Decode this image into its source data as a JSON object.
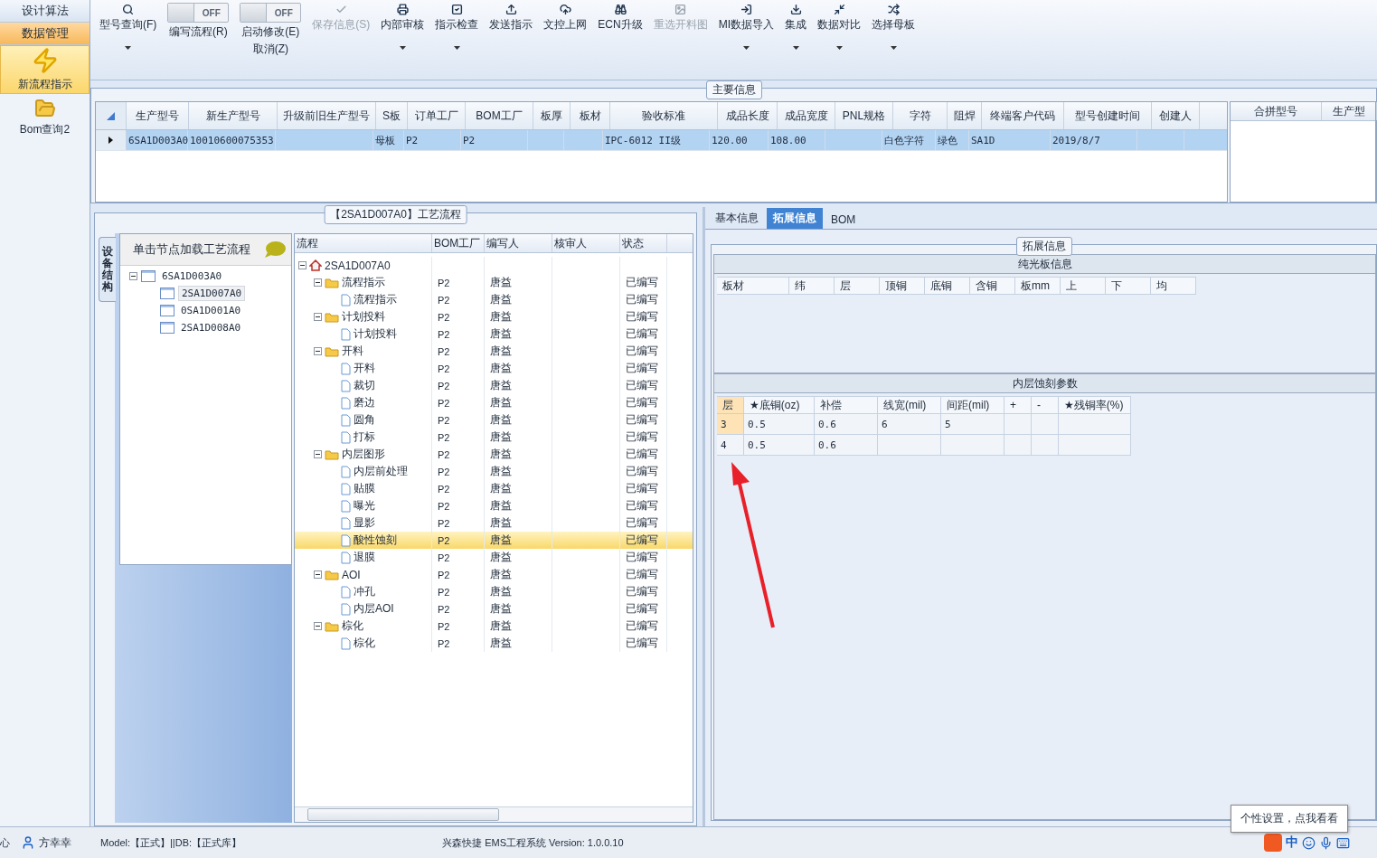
{
  "sidebar": {
    "tabs": [
      {
        "label": "设计算法",
        "selected": false
      },
      {
        "label": "数据管理",
        "selected": true
      }
    ],
    "buttons": [
      {
        "label": "新流程指示",
        "selected": true
      },
      {
        "label": "Bom查询2",
        "selected": false
      }
    ]
  },
  "toolbar": [
    {
      "kind": "button",
      "label": "型号查询(F)",
      "disabled": false,
      "dropdown": true
    },
    {
      "kind": "toggle",
      "label": "编写流程(R)",
      "switch": "OFF",
      "on": false
    },
    {
      "kind": "toggle",
      "label": "启动修改(E)",
      "label_2": "取消(Z)",
      "switch": "OFF",
      "on": false
    },
    {
      "kind": "button",
      "label": "保存信息(S)",
      "disabled": true,
      "dropdown": false
    },
    {
      "kind": "button",
      "label": "内部审核",
      "disabled": false,
      "dropdown": true
    },
    {
      "kind": "button",
      "label": "指示检查",
      "disabled": false,
      "dropdown": true
    },
    {
      "kind": "button",
      "label": "发送指示",
      "disabled": false,
      "dropdown": false
    },
    {
      "kind": "button",
      "label": "文控上网",
      "disabled": false,
      "dropdown": false
    },
    {
      "kind": "button",
      "label": "ECN升级",
      "disabled": false,
      "dropdown": false
    },
    {
      "kind": "button",
      "label": "重选开料图",
      "disabled": true,
      "dropdown": false
    },
    {
      "kind": "button",
      "label": "MI数据导入",
      "disabled": false,
      "dropdown": true
    },
    {
      "kind": "button",
      "label": "集成",
      "disabled": false,
      "dropdown": true
    },
    {
      "kind": "button",
      "label": "数据对比",
      "disabled": false,
      "dropdown": true
    },
    {
      "kind": "button",
      "label": "选择母板",
      "disabled": false,
      "dropdown": true
    }
  ],
  "main_info": {
    "title": "主要信息",
    "columns": [
      "生产型号",
      "新生产型号",
      "升级前旧生产型号",
      "S板",
      "订单工厂",
      "BOM工厂",
      "板厚",
      "板材",
      "验收标准",
      "成品长度",
      "成品宽度",
      "PNL规格",
      "字符",
      "阻焊",
      "终端客户代码",
      "型号创建时间",
      "创建人"
    ],
    "rows": [
      {
        "selected": true,
        "cells": [
          "6SA1D003A0",
          "10010600075353",
          null,
          "母板",
          "P2",
          "P2",
          null,
          null,
          "IPC-6012 II级",
          "120.00",
          "108.00",
          null,
          "白色字符",
          "绿色",
          "SA1D",
          "2019/8/7",
          null
        ]
      }
    ],
    "side_columns": [
      "合拼型号",
      "生产型"
    ]
  },
  "flow_panel": {
    "title": "【2SA1D007A0】工艺流程",
    "side_tab": "设备结构",
    "hint": "单击节点加载工艺流程",
    "model_tree": [
      {
        "label": "6SA1D003A0",
        "expanded": true,
        "selected": false,
        "children": [
          {
            "label": "2SA1D007A0",
            "selected": true
          },
          {
            "label": "0SA1D001A0",
            "selected": false
          },
          {
            "label": "2SA1D008A0",
            "selected": false
          }
        ]
      }
    ],
    "columns": [
      "流程",
      "BOM工厂",
      "编写人",
      "核审人",
      "状态"
    ],
    "rows": [
      {
        "name": "2SA1D007A0",
        "kind": "root",
        "expanded": true,
        "selected": false,
        "children": [
          {
            "name": "流程指示",
            "kind": "folder",
            "expanded": true,
            "selected": false,
            "bom": "P2",
            "writer": "唐益",
            "status": "已编写",
            "children": [
              {
                "name": "流程指示",
                "kind": "step",
                "selected": false,
                "bom": "P2",
                "writer": "唐益",
                "status": "已编写"
              }
            ]
          },
          {
            "name": "计划投料",
            "kind": "folder",
            "expanded": true,
            "selected": false,
            "bom": "P2",
            "writer": "唐益",
            "status": "已编写",
            "children": [
              {
                "name": "计划投料",
                "kind": "step",
                "selected": false,
                "bom": "P2",
                "writer": "唐益",
                "status": "已编写"
              }
            ]
          },
          {
            "name": "开料",
            "kind": "folder",
            "expanded": true,
            "selected": false,
            "bom": "P2",
            "writer": "唐益",
            "status": "已编写",
            "children": [
              {
                "name": "开料",
                "kind": "step",
                "selected": false,
                "bom": "P2",
                "writer": "唐益",
                "status": "已编写"
              },
              {
                "name": "裁切",
                "kind": "step",
                "selected": false,
                "bom": "P2",
                "writer": "唐益",
                "status": "已编写"
              },
              {
                "name": "磨边",
                "kind": "step",
                "selected": false,
                "bom": "P2",
                "writer": "唐益",
                "status": "已编写"
              },
              {
                "name": "圆角",
                "kind": "step",
                "selected": false,
                "bom": "P2",
                "writer": "唐益",
                "status": "已编写"
              },
              {
                "name": "打标",
                "kind": "step",
                "selected": false,
                "bom": "P2",
                "writer": "唐益",
                "status": "已编写"
              }
            ]
          },
          {
            "name": "内层图形",
            "kind": "folder",
            "expanded": true,
            "selected": false,
            "bom": "P2",
            "writer": "唐益",
            "status": "已编写",
            "children": [
              {
                "name": "内层前处理",
                "kind": "step",
                "selected": false,
                "bom": "P2",
                "writer": "唐益",
                "status": "已编写"
              },
              {
                "name": "贴膜",
                "kind": "step",
                "selected": false,
                "bom": "P2",
                "writer": "唐益",
                "status": "已编写"
              },
              {
                "name": "曝光",
                "kind": "step",
                "selected": false,
                "bom": "P2",
                "writer": "唐益",
                "status": "已编写"
              },
              {
                "name": "显影",
                "kind": "step",
                "selected": false,
                "bom": "P2",
                "writer": "唐益",
                "status": "已编写"
              },
              {
                "name": "酸性蚀刻",
                "kind": "step",
                "selected": true,
                "bom": "P2",
                "writer": "唐益",
                "status": "已编写"
              },
              {
                "name": "退膜",
                "kind": "step",
                "selected": false,
                "bom": "P2",
                "writer": "唐益",
                "status": "已编写"
              }
            ]
          },
          {
            "name": "AOI",
            "kind": "folder",
            "expanded": true,
            "selected": false,
            "bom": "P2",
            "writer": "唐益",
            "status": "已编写",
            "children": [
              {
                "name": "冲孔",
                "kind": "step",
                "selected": false,
                "bom": "P2",
                "writer": "唐益",
                "status": "已编写"
              },
              {
                "name": "内层AOI",
                "kind": "step",
                "selected": false,
                "bom": "P2",
                "writer": "唐益",
                "status": "已编写"
              }
            ]
          },
          {
            "name": "棕化",
            "kind": "folder",
            "expanded": true,
            "selected": false,
            "bom": "P2",
            "writer": "唐益",
            "status": "已编写",
            "children": [
              {
                "name": "棕化",
                "kind": "step",
                "selected": false,
                "bom": "P2",
                "writer": "唐益",
                "status": "已编写"
              }
            ]
          }
        ]
      }
    ]
  },
  "detail_panel": {
    "tabs": [
      {
        "label": "基本信息",
        "selected": false
      },
      {
        "label": "拓展信息",
        "selected": true
      },
      {
        "label": "BOM",
        "selected": false
      }
    ],
    "title": "拓展信息",
    "bare_board": {
      "title": "纯光板信息",
      "columns": [
        "板材",
        "纬",
        "层",
        "顶铜",
        "底铜",
        "含铜",
        "板mm",
        "上",
        "下",
        "均"
      ]
    },
    "etching": {
      "title": "内层蚀刻参数",
      "columns": [
        "层",
        "★底铜(oz)",
        "补偿",
        "线宽(mil)",
        "间距(mil)",
        "+",
        "-",
        "★残铜率(%)"
      ],
      "rows": [
        {
          "selected": true,
          "cells": [
            "3",
            "0.5",
            "0.6",
            "6",
            "5",
            null,
            null,
            null
          ]
        },
        {
          "selected": false,
          "cells": [
            "4",
            "0.5",
            "0.6",
            null,
            null,
            null,
            null,
            null
          ]
        }
      ]
    }
  },
  "status_bar": {
    "left_fragment": "心",
    "user": "方幸幸",
    "env": "Model:【正式】||DB:【正式库】",
    "app": "兴森快捷 EMS工程系统 Version: 1.0.0.10",
    "tooltip": "个性设置，点我看看",
    "ime": "中"
  }
}
